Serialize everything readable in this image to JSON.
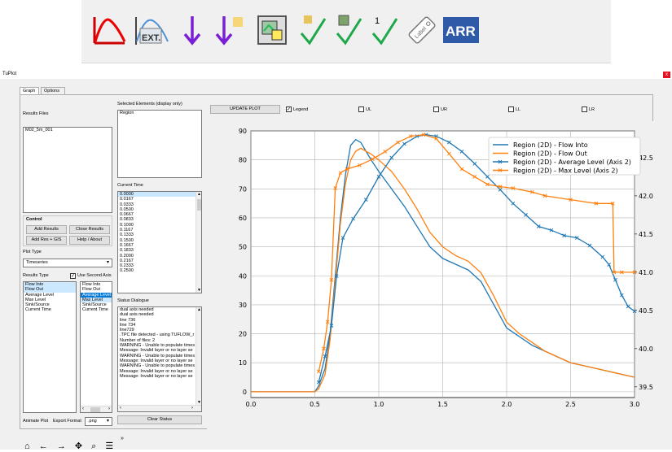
{
  "toolbar": {
    "buttons": [
      {
        "name": "hydrograph-red-icon"
      },
      {
        "name": "ext-icon",
        "text": "EXT."
      },
      {
        "name": "arrow-down-icon"
      },
      {
        "name": "arrow-down-new-icon"
      },
      {
        "name": "map-add-icon"
      },
      {
        "name": "check-folder-icon"
      },
      {
        "name": "check-layer-icon"
      },
      {
        "name": "check-one-icon",
        "text": "1"
      },
      {
        "name": "label-tag-icon",
        "text": "Label"
      },
      {
        "name": "arr-icon",
        "text": "ARR"
      }
    ]
  },
  "window": {
    "title": "TuPlot",
    "close": "x",
    "tabs": [
      "Graph",
      "Options"
    ]
  },
  "left": {
    "results_files_label": "Results Files",
    "results_files": [
      "M02_5m_001"
    ],
    "control_label": "Control",
    "add_results": "Add Results",
    "close_results": "Close Results",
    "add_res_gis": "Add Res + GIS",
    "help_about": "Help / About",
    "plot_type_label": "Plot Type",
    "plot_type_value": "Timeseries",
    "results_type_label": "Results Type",
    "use_second_axis": "Use Second Axis",
    "results_type_list": [
      "Flow Into",
      "Flow Out",
      "Average Level",
      "Max Level",
      "Sink/Source",
      "Current Time"
    ],
    "secondary_list": [
      "Flow Into",
      "Flow Out",
      "Average Level",
      "Max Level",
      "Sink/Source",
      "Current Time"
    ],
    "animate_plot": "Animate Plot",
    "export_format": "Export Format",
    "export_value": ".png"
  },
  "middle": {
    "selected_elements_label": "Selected Elements (display only)",
    "selected_elements": [
      "Region"
    ],
    "current_time_label": "Current Time",
    "times": [
      "0.0000",
      "0.0167",
      "0.0333",
      "0.0500",
      "0.0667",
      "0.0833",
      "0.1000",
      "0.1167",
      "0.1333",
      "0.1500",
      "0.1667",
      "0.1833",
      "0.2000",
      "0.2167",
      "0.2333",
      "0.2500"
    ],
    "status_label": "Status Dialogue",
    "status_lines": [
      "dual axis needed",
      "dual axis needed",
      "line 736",
      "line 734",
      "line729",
      ".TPC file detected - using TUFLOW_r",
      "Number of files: 2",
      "WARNING - Unable to populate times",
      "Message: Invalid layer or no layer se",
      "WARNING - Unable to populate times",
      "Message: Invalid layer or no layer se",
      "WARNING - Unable to populate times",
      "Message: Invalid layer or no layer se",
      "Message: Invalid layer or no layer se"
    ],
    "clear_status": "Clear Status"
  },
  "plotbar": {
    "update_plot": "UPDATE PLOT",
    "legend": "Legend",
    "ul": "UL",
    "ur": "UR",
    "ll": "LL",
    "lr": "LR"
  },
  "nav": {
    "home": "⌂",
    "back": "←",
    "forward": "→",
    "pan": "✥",
    "zoom": "⌕",
    "config": "☰",
    "more": "»"
  },
  "chart_data": {
    "type": "line",
    "x_ticks": [
      "0.0",
      "0.5",
      "1.0",
      "1.5",
      "2.0",
      "2.5",
      "3.0"
    ],
    "y_ticks": [
      "0",
      "10",
      "20",
      "30",
      "40",
      "50",
      "60",
      "70",
      "80",
      "90"
    ],
    "y2_ticks": [
      "39.5",
      "40.0",
      "40.5",
      "41.0",
      "41.5",
      "42.0",
      "42.5"
    ],
    "xlim": [
      0,
      3.0
    ],
    "ylim": [
      -2,
      90
    ],
    "y2lim": [
      39.36,
      42.85
    ],
    "legend_position": "top-right",
    "colors": {
      "blue": "#1f77b4",
      "orange": "#ff7f0e"
    },
    "series": [
      {
        "name": "Region (2D) - Flow Into",
        "axis": "left",
        "color": "#1f77b4",
        "marker": "",
        "x": [
          0,
          0.5,
          0.53,
          0.58,
          0.62,
          0.66,
          0.7,
          0.74,
          0.78,
          0.82,
          0.86,
          0.9,
          0.94,
          1.0,
          1.1,
          1.2,
          1.3,
          1.4,
          1.5,
          1.6,
          1.7,
          1.8,
          1.9,
          2.0,
          2.1,
          2.2,
          2.3,
          2.4,
          2.5,
          2.6,
          2.7,
          2.8,
          2.9,
          3.0
        ],
        "y": [
          0,
          0,
          2,
          8,
          20,
          40,
          60,
          75,
          85,
          87,
          86,
          83,
          80,
          76,
          70,
          64,
          57,
          50,
          46,
          44,
          42,
          38,
          30,
          22,
          19,
          16,
          14,
          12,
          10,
          9,
          8,
          7,
          6,
          5
        ]
      },
      {
        "name": "Region (2D) - Flow Out",
        "axis": "left",
        "color": "#ff7f0e",
        "marker": "",
        "x": [
          0,
          0.5,
          0.53,
          0.58,
          0.62,
          0.66,
          0.7,
          0.74,
          0.78,
          0.82,
          0.86,
          0.9,
          0.94,
          1.0,
          1.1,
          1.2,
          1.3,
          1.4,
          1.5,
          1.6,
          1.7,
          1.8,
          1.9,
          2.0,
          2.1,
          2.2,
          2.3,
          2.4,
          2.5,
          2.6,
          2.7,
          2.8,
          2.9,
          3.0
        ],
        "y": [
          0,
          0,
          1,
          6,
          18,
          38,
          58,
          72,
          80,
          83,
          84,
          83,
          82,
          80,
          76,
          70,
          63,
          55,
          50,
          47,
          45,
          41,
          33,
          24,
          20,
          17,
          14,
          12,
          10,
          9,
          8,
          7,
          6,
          5
        ]
      },
      {
        "name": "Region (2D) - Average Level (Axis 2)",
        "axis": "right",
        "color": "#1f77b4",
        "marker": "x",
        "x": [
          0.53,
          0.58,
          0.63,
          0.67,
          0.72,
          0.8,
          0.9,
          1.0,
          1.1,
          1.2,
          1.3,
          1.37,
          1.45,
          1.55,
          1.65,
          1.75,
          1.85,
          1.95,
          2.05,
          2.15,
          2.25,
          2.35,
          2.45,
          2.55,
          2.65,
          2.75,
          2.8,
          2.85,
          2.9,
          2.95,
          3.0
        ],
        "y": [
          39.56,
          39.9,
          40.3,
          40.95,
          41.45,
          41.7,
          41.95,
          42.25,
          42.5,
          42.68,
          42.78,
          42.8,
          42.78,
          42.7,
          42.58,
          42.42,
          42.25,
          42.08,
          41.9,
          41.75,
          41.6,
          41.55,
          41.48,
          41.45,
          41.35,
          41.2,
          41.1,
          40.9,
          40.7,
          40.55,
          40.49
        ]
      },
      {
        "name": "Region (2D) - Max Level (Axis 2)",
        "axis": "right",
        "color": "#ff7f0e",
        "marker": "x",
        "x": [
          0.53,
          0.57,
          0.6,
          0.63,
          0.66,
          0.7,
          0.75,
          0.85,
          0.95,
          1.05,
          1.15,
          1.25,
          1.35,
          1.45,
          1.55,
          1.65,
          1.75,
          1.85,
          1.95,
          2.05,
          2.2,
          2.3,
          2.5,
          2.7,
          2.83,
          2.84,
          2.9,
          3.0
        ],
        "y": [
          39.7,
          40.0,
          40.35,
          40.9,
          42.1,
          42.3,
          42.35,
          42.4,
          42.48,
          42.58,
          42.7,
          42.78,
          42.8,
          42.75,
          42.55,
          42.35,
          42.25,
          42.15,
          42.12,
          42.1,
          42.05,
          42.0,
          41.95,
          41.9,
          41.9,
          41.0,
          41.0,
          41.0
        ]
      }
    ]
  }
}
